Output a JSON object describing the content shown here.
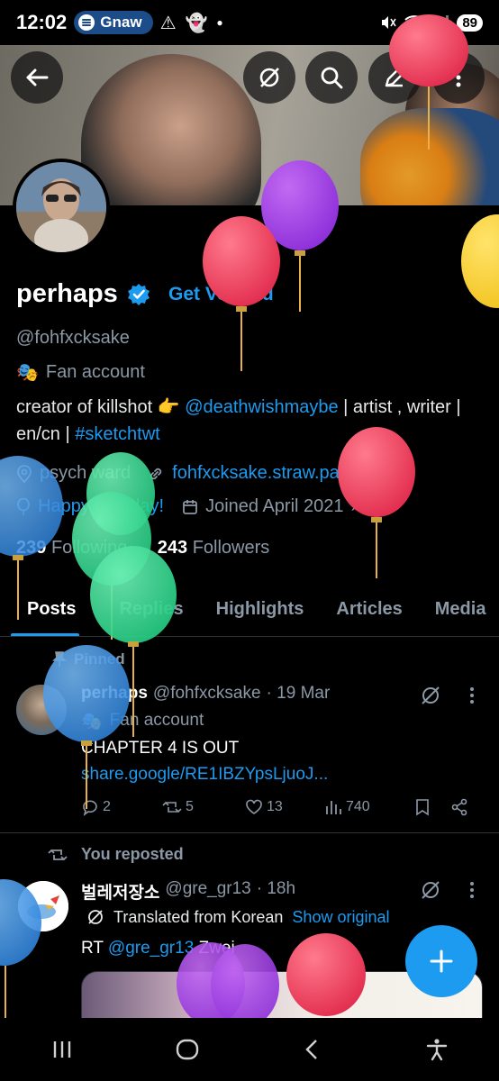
{
  "status_bar": {
    "time": "12:02",
    "media_app": "Gnaw",
    "battery": "89"
  },
  "profile": {
    "display_name": "perhaps",
    "get_verified": "Get Verified",
    "handle": "@fohfxcksake",
    "category": "Fan account",
    "bio_prefix": "creator of killshot",
    "bio_emoji": "👉",
    "bio_mention": "@deathwishmaybe",
    "bio_mid": "| artist , writer | en/cn |",
    "bio_hashtag": "#sketchtwt",
    "location": "psych ward",
    "website": "fohfxcksake.straw.page",
    "birthday": "Happy birthday!",
    "joined": "Joined April 2021",
    "following_count": "239",
    "following_label": "Following",
    "followers_count": "243",
    "followers_label": "Followers"
  },
  "tabs": [
    "Posts",
    "Replies",
    "Highlights",
    "Articles",
    "Media"
  ],
  "pinned_post": {
    "pinned_label": "Pinned",
    "author_name": "perhaps",
    "author_handle": "@fohfxcksake",
    "time": "· 19 Mar",
    "category": "Fan account",
    "text": "CHAPTER 4 IS OUT",
    "link": "share.google/RE1IBZYpsLjuoJ...",
    "replies": "2",
    "reposts": "5",
    "likes": "13",
    "views": "740"
  },
  "repost": {
    "repost_label": "You reposted",
    "author_name": "벌레저장소",
    "author_handle": "@gre_gr13",
    "time": "· 18h",
    "translated_label": "Translated from Korean",
    "show_original": "Show original",
    "text_prefix": "RT",
    "text_mention": "@gre_gr13",
    "text_suffix": "Zwei"
  },
  "colors": {
    "accent": "#1d9bf0",
    "background": "#000000",
    "secondary_text": "#8b98a5"
  },
  "icons": [
    "back-arrow-icon",
    "grok-icon",
    "search-icon",
    "compose-icon",
    "more-vertical-icon",
    "verified-badge-icon",
    "theater-mask-icon",
    "location-icon",
    "link-icon",
    "balloon-icon",
    "calendar-icon",
    "chevron-right-icon",
    "pin-icon",
    "reply-icon",
    "repost-icon",
    "like-icon",
    "views-icon",
    "bookmark-icon",
    "share-icon",
    "translate-icon",
    "plus-icon",
    "recents-icon",
    "home-icon",
    "back-icon",
    "accessibility-icon"
  ]
}
